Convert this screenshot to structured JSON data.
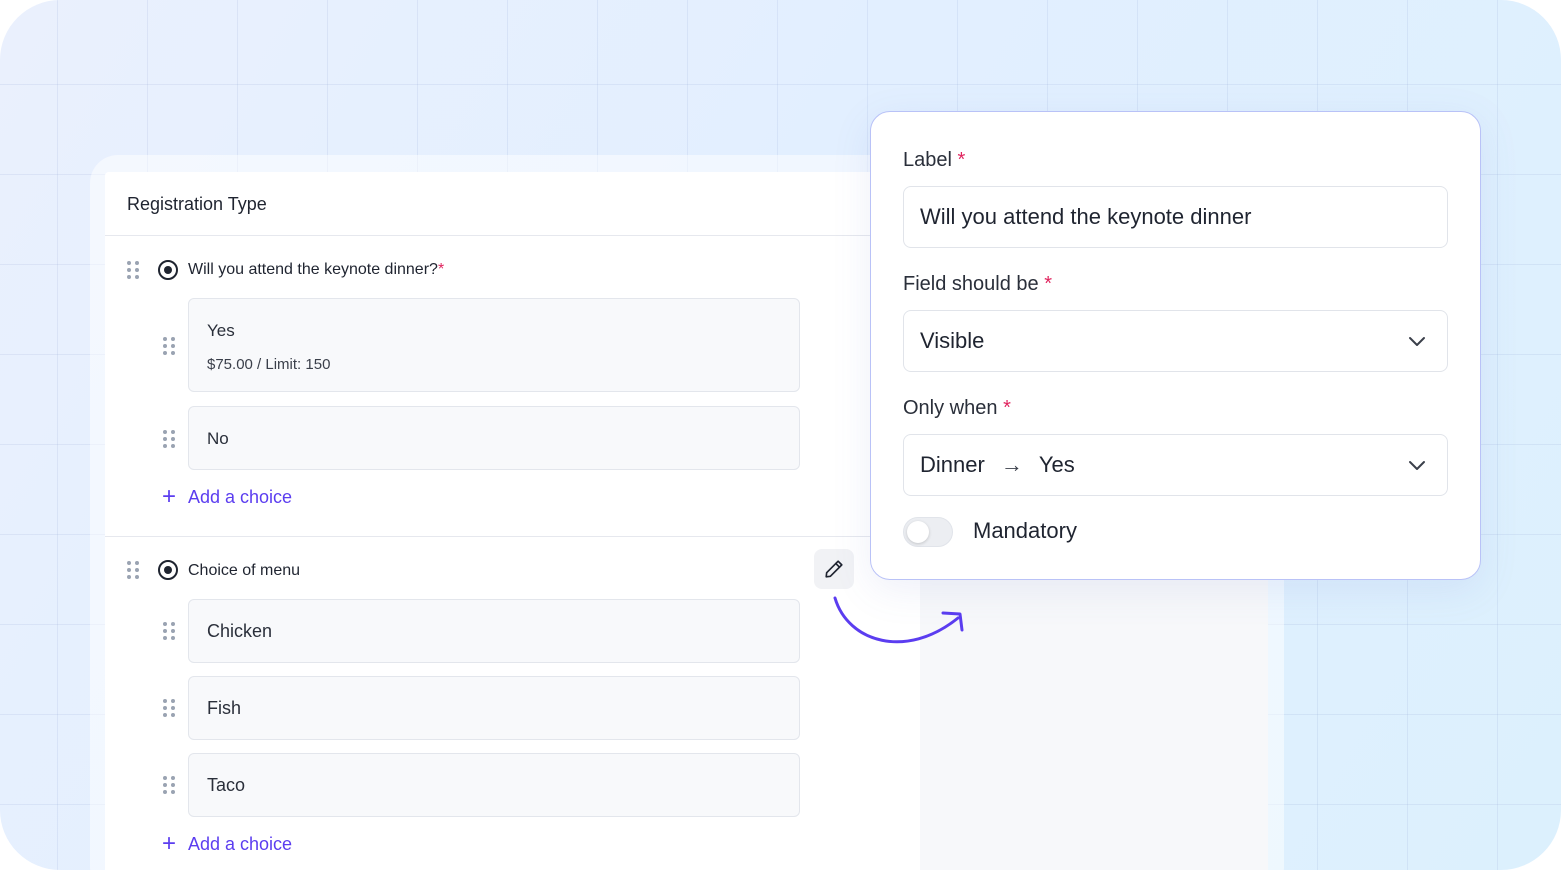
{
  "form": {
    "section_title": "Registration Type",
    "questions": [
      {
        "label": "Will you attend the keynote dinner?",
        "required_mark": "*",
        "choices": [
          {
            "label": "Yes",
            "detail": "$75.00 / Limit: 150"
          },
          {
            "label": "No"
          }
        ],
        "add_choice_label": "Add a choice"
      },
      {
        "label": "Choice of menu",
        "choices": [
          {
            "label": "Chicken"
          },
          {
            "label": "Fish"
          },
          {
            "label": "Taco"
          }
        ],
        "add_choice_label": "Add a choice"
      }
    ]
  },
  "popover": {
    "label_field": {
      "label": "Label",
      "required_mark": "*",
      "value": "Will you attend the keynote dinner"
    },
    "visibility_field": {
      "label": "Field should be",
      "required_mark": "*",
      "value": "Visible"
    },
    "condition_field": {
      "label": "Only when",
      "required_mark": "*",
      "source": "Dinner",
      "arrow": "→",
      "target": "Yes"
    },
    "mandatory_toggle": {
      "label": "Mandatory",
      "on": false
    }
  },
  "icons": {
    "drag_handle": "drag-handle-icon",
    "radio": "radio-icon",
    "edit": "pencil-icon",
    "dropdown": "chevron-down-icon",
    "connector": "curved-arrow-icon"
  },
  "colors": {
    "accent": "#5b3df0",
    "required": "#e0245e",
    "popover_border": "#b9c2f7"
  }
}
